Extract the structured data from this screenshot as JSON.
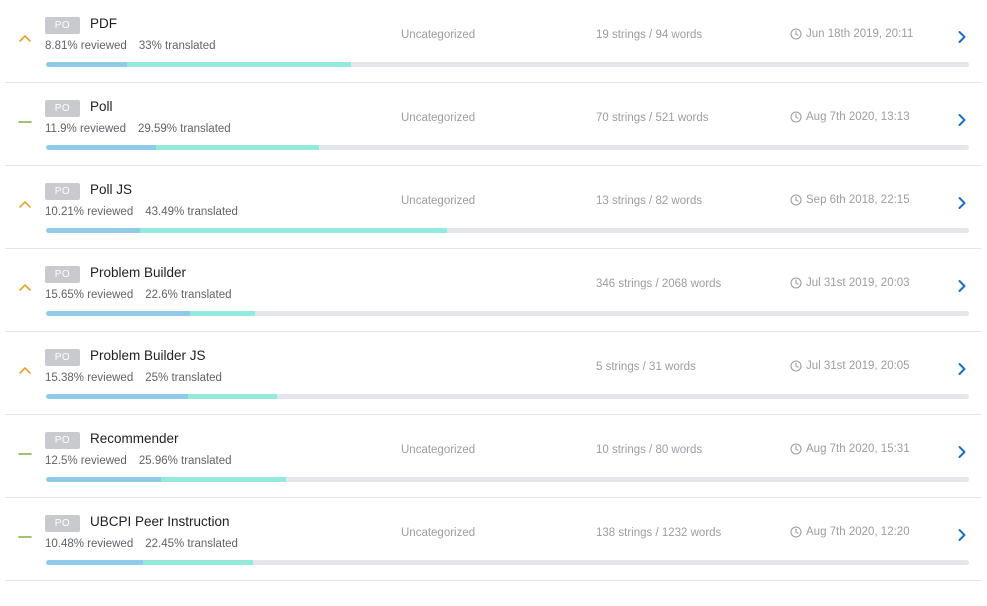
{
  "colors": {
    "priority_high": "#e5a332",
    "priority_normal": "#7fb23a",
    "chevron": "#1f6fbe",
    "reviewed_bar": "#8fcbe8",
    "translated_bar": "#93eadc",
    "track": "#e4e6ec"
  },
  "resources": [
    {
      "badge": "PO",
      "name": "PDF",
      "priority": "high",
      "priority_icon": "chevron-up-icon",
      "reviewed": "8.81% reviewed",
      "translated": "33% translated",
      "reviewed_pct": 8.81,
      "translated_pct": 33,
      "category": "Uncategorized",
      "counts": "19 strings / 94 words",
      "updated": "Jun 18th 2019, 20:11"
    },
    {
      "badge": "PO",
      "name": "Poll",
      "priority": "normal",
      "priority_icon": "dash-icon",
      "reviewed": "11.9% reviewed",
      "translated": "29.59% translated",
      "reviewed_pct": 11.9,
      "translated_pct": 29.59,
      "category": "Uncategorized",
      "counts": "70 strings / 521 words",
      "updated": "Aug 7th 2020, 13:13"
    },
    {
      "badge": "PO",
      "name": "Poll JS",
      "priority": "high",
      "priority_icon": "chevron-up-icon",
      "reviewed": "10.21% reviewed",
      "translated": "43.49% translated",
      "reviewed_pct": 10.21,
      "translated_pct": 43.49,
      "category": "Uncategorized",
      "counts": "13 strings / 82 words",
      "updated": "Sep 6th 2018, 22:15"
    },
    {
      "badge": "PO",
      "name": "Problem Builder",
      "priority": "high",
      "priority_icon": "chevron-up-icon",
      "reviewed": "15.65% reviewed",
      "translated": "22.6% translated",
      "reviewed_pct": 15.65,
      "translated_pct": 22.6,
      "category": "",
      "counts": "346 strings / 2068 words",
      "updated": "Jul 31st 2019, 20:03"
    },
    {
      "badge": "PO",
      "name": "Problem Builder JS",
      "priority": "high",
      "priority_icon": "chevron-up-icon",
      "reviewed": "15.38% reviewed",
      "translated": "25% translated",
      "reviewed_pct": 15.38,
      "translated_pct": 25,
      "category": "",
      "counts": "5 strings / 31 words",
      "updated": "Jul 31st 2019, 20:05"
    },
    {
      "badge": "PO",
      "name": "Recommender",
      "priority": "normal",
      "priority_icon": "dash-icon",
      "reviewed": "12.5% reviewed",
      "translated": "25.96% translated",
      "reviewed_pct": 12.5,
      "translated_pct": 25.96,
      "category": "Uncategorized",
      "counts": "10 strings / 80 words",
      "updated": "Aug 7th 2020, 15:31"
    },
    {
      "badge": "PO",
      "name": "UBCPI Peer Instruction",
      "priority": "normal",
      "priority_icon": "dash-icon",
      "reviewed": "10.48% reviewed",
      "translated": "22.45% translated",
      "reviewed_pct": 10.48,
      "translated_pct": 22.45,
      "category": "Uncategorized",
      "counts": "138 strings / 1232 words",
      "updated": "Aug 7th 2020, 12:20"
    }
  ]
}
